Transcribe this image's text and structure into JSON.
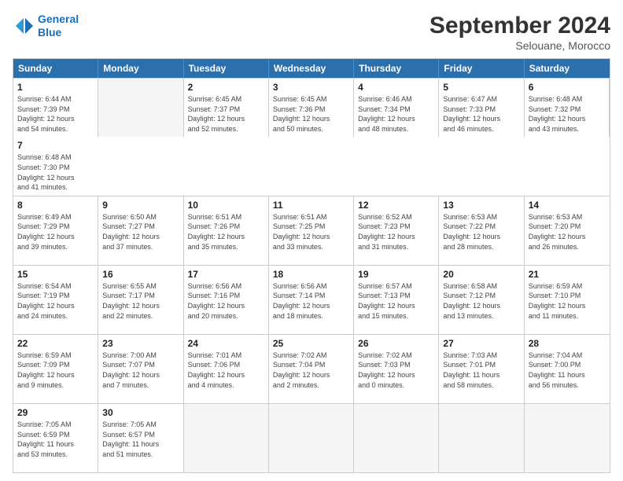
{
  "logo": {
    "line1": "General",
    "line2": "Blue"
  },
  "header": {
    "month": "September 2024",
    "location": "Selouane, Morocco"
  },
  "weekdays": [
    "Sunday",
    "Monday",
    "Tuesday",
    "Wednesday",
    "Thursday",
    "Friday",
    "Saturday"
  ],
  "rows": [
    [
      {
        "empty": true
      },
      {
        "day": "2",
        "info": "Sunrise: 6:45 AM\nSunset: 7:37 PM\nDaylight: 12 hours\nand 52 minutes."
      },
      {
        "day": "3",
        "info": "Sunrise: 6:45 AM\nSunset: 7:36 PM\nDaylight: 12 hours\nand 50 minutes."
      },
      {
        "day": "4",
        "info": "Sunrise: 6:46 AM\nSunset: 7:34 PM\nDaylight: 12 hours\nand 48 minutes."
      },
      {
        "day": "5",
        "info": "Sunrise: 6:47 AM\nSunset: 7:33 PM\nDaylight: 12 hours\nand 46 minutes."
      },
      {
        "day": "6",
        "info": "Sunrise: 6:48 AM\nSunset: 7:32 PM\nDaylight: 12 hours\nand 43 minutes."
      },
      {
        "day": "7",
        "info": "Sunrise: 6:48 AM\nSunset: 7:30 PM\nDaylight: 12 hours\nand 41 minutes."
      }
    ],
    [
      {
        "day": "8",
        "info": "Sunrise: 6:49 AM\nSunset: 7:29 PM\nDaylight: 12 hours\nand 39 minutes."
      },
      {
        "day": "9",
        "info": "Sunrise: 6:50 AM\nSunset: 7:27 PM\nDaylight: 12 hours\nand 37 minutes."
      },
      {
        "day": "10",
        "info": "Sunrise: 6:51 AM\nSunset: 7:26 PM\nDaylight: 12 hours\nand 35 minutes."
      },
      {
        "day": "11",
        "info": "Sunrise: 6:51 AM\nSunset: 7:25 PM\nDaylight: 12 hours\nand 33 minutes."
      },
      {
        "day": "12",
        "info": "Sunrise: 6:52 AM\nSunset: 7:23 PM\nDaylight: 12 hours\nand 31 minutes."
      },
      {
        "day": "13",
        "info": "Sunrise: 6:53 AM\nSunset: 7:22 PM\nDaylight: 12 hours\nand 28 minutes."
      },
      {
        "day": "14",
        "info": "Sunrise: 6:53 AM\nSunset: 7:20 PM\nDaylight: 12 hours\nand 26 minutes."
      }
    ],
    [
      {
        "day": "15",
        "info": "Sunrise: 6:54 AM\nSunset: 7:19 PM\nDaylight: 12 hours\nand 24 minutes."
      },
      {
        "day": "16",
        "info": "Sunrise: 6:55 AM\nSunset: 7:17 PM\nDaylight: 12 hours\nand 22 minutes."
      },
      {
        "day": "17",
        "info": "Sunrise: 6:56 AM\nSunset: 7:16 PM\nDaylight: 12 hours\nand 20 minutes."
      },
      {
        "day": "18",
        "info": "Sunrise: 6:56 AM\nSunset: 7:14 PM\nDaylight: 12 hours\nand 18 minutes."
      },
      {
        "day": "19",
        "info": "Sunrise: 6:57 AM\nSunset: 7:13 PM\nDaylight: 12 hours\nand 15 minutes."
      },
      {
        "day": "20",
        "info": "Sunrise: 6:58 AM\nSunset: 7:12 PM\nDaylight: 12 hours\nand 13 minutes."
      },
      {
        "day": "21",
        "info": "Sunrise: 6:59 AM\nSunset: 7:10 PM\nDaylight: 12 hours\nand 11 minutes."
      }
    ],
    [
      {
        "day": "22",
        "info": "Sunrise: 6:59 AM\nSunset: 7:09 PM\nDaylight: 12 hours\nand 9 minutes."
      },
      {
        "day": "23",
        "info": "Sunrise: 7:00 AM\nSunset: 7:07 PM\nDaylight: 12 hours\nand 7 minutes."
      },
      {
        "day": "24",
        "info": "Sunrise: 7:01 AM\nSunset: 7:06 PM\nDaylight: 12 hours\nand 4 minutes."
      },
      {
        "day": "25",
        "info": "Sunrise: 7:02 AM\nSunset: 7:04 PM\nDaylight: 12 hours\nand 2 minutes."
      },
      {
        "day": "26",
        "info": "Sunrise: 7:02 AM\nSunset: 7:03 PM\nDaylight: 12 hours\nand 0 minutes."
      },
      {
        "day": "27",
        "info": "Sunrise: 7:03 AM\nSunset: 7:01 PM\nDaylight: 11 hours\nand 58 minutes."
      },
      {
        "day": "28",
        "info": "Sunrise: 7:04 AM\nSunset: 7:00 PM\nDaylight: 11 hours\nand 56 minutes."
      }
    ],
    [
      {
        "day": "29",
        "info": "Sunrise: 7:05 AM\nSunset: 6:59 PM\nDaylight: 11 hours\nand 53 minutes."
      },
      {
        "day": "30",
        "info": "Sunrise: 7:05 AM\nSunset: 6:57 PM\nDaylight: 11 hours\nand 51 minutes."
      },
      {
        "empty": true
      },
      {
        "empty": true
      },
      {
        "empty": true
      },
      {
        "empty": true
      },
      {
        "empty": true
      }
    ]
  ],
  "row0_day1": {
    "day": "1",
    "info": "Sunrise: 6:44 AM\nSunset: 7:39 PM\nDaylight: 12 hours\nand 54 minutes."
  }
}
